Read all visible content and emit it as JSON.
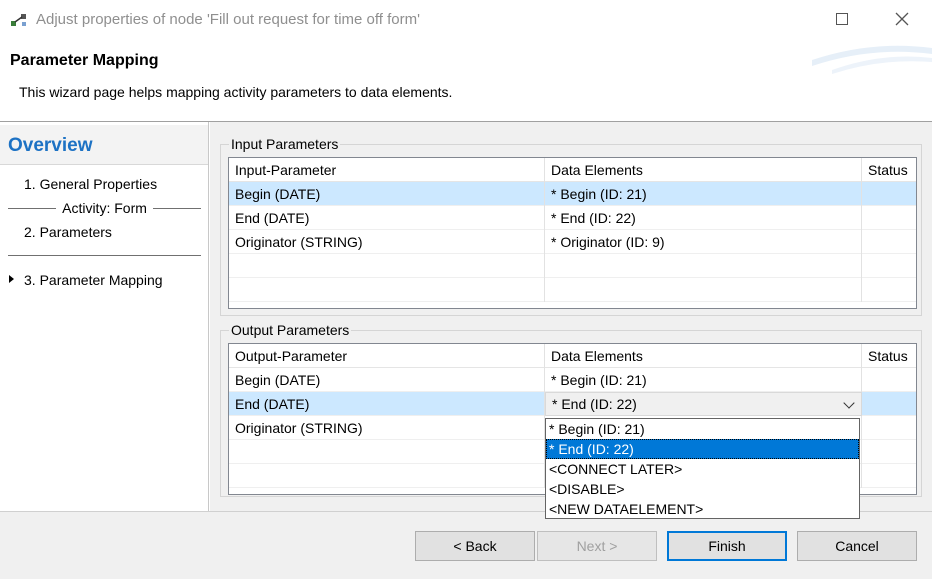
{
  "window": {
    "title": "Adjust properties of node 'Fill out request for time off form'"
  },
  "header": {
    "title": "Parameter Mapping",
    "description": "This wizard page helps mapping activity parameters to data elements."
  },
  "sidebar": {
    "title": "Overview",
    "items": [
      {
        "label": "1.  General Properties"
      },
      {
        "label": "Activity: Form"
      },
      {
        "label": "2.  Parameters"
      },
      {
        "label": "3.  Parameter Mapping"
      }
    ]
  },
  "input_group": {
    "label": "Input Parameters",
    "headers": [
      "Input-Parameter",
      "Data Elements",
      "Status"
    ],
    "rows": [
      {
        "param": "Begin  (DATE)",
        "element": "* Begin  (ID: 21)",
        "status": ""
      },
      {
        "param": "End  (DATE)",
        "element": "* End  (ID: 22)",
        "status": ""
      },
      {
        "param": "Originator  (STRING)",
        "element": "* Originator  (ID: 9)",
        "status": ""
      }
    ]
  },
  "output_group": {
    "label": "Output Parameters",
    "headers": [
      "Output-Parameter",
      "Data Elements",
      "Status"
    ],
    "rows": [
      {
        "param": "Begin  (DATE)",
        "element": "* Begin  (ID: 21)",
        "status": ""
      },
      {
        "param": "End  (DATE)",
        "element": "* End  (ID: 22)",
        "status": ""
      },
      {
        "param": "Originator  (STRING)",
        "element": "",
        "status": ""
      }
    ]
  },
  "dropdown": {
    "options": [
      "* Begin  (ID: 21)",
      "* End  (ID: 22)",
      "<CONNECT LATER>",
      "<DISABLE>",
      "<NEW DATAELEMENT>"
    ],
    "selected_index": 1
  },
  "footer": {
    "back": "< Back",
    "next": "Next >",
    "finish": "Finish",
    "cancel": "Cancel"
  },
  "colors": {
    "accent": "#0078d7",
    "selection_row": "#cce8ff",
    "overview_title": "#1d72c4"
  }
}
